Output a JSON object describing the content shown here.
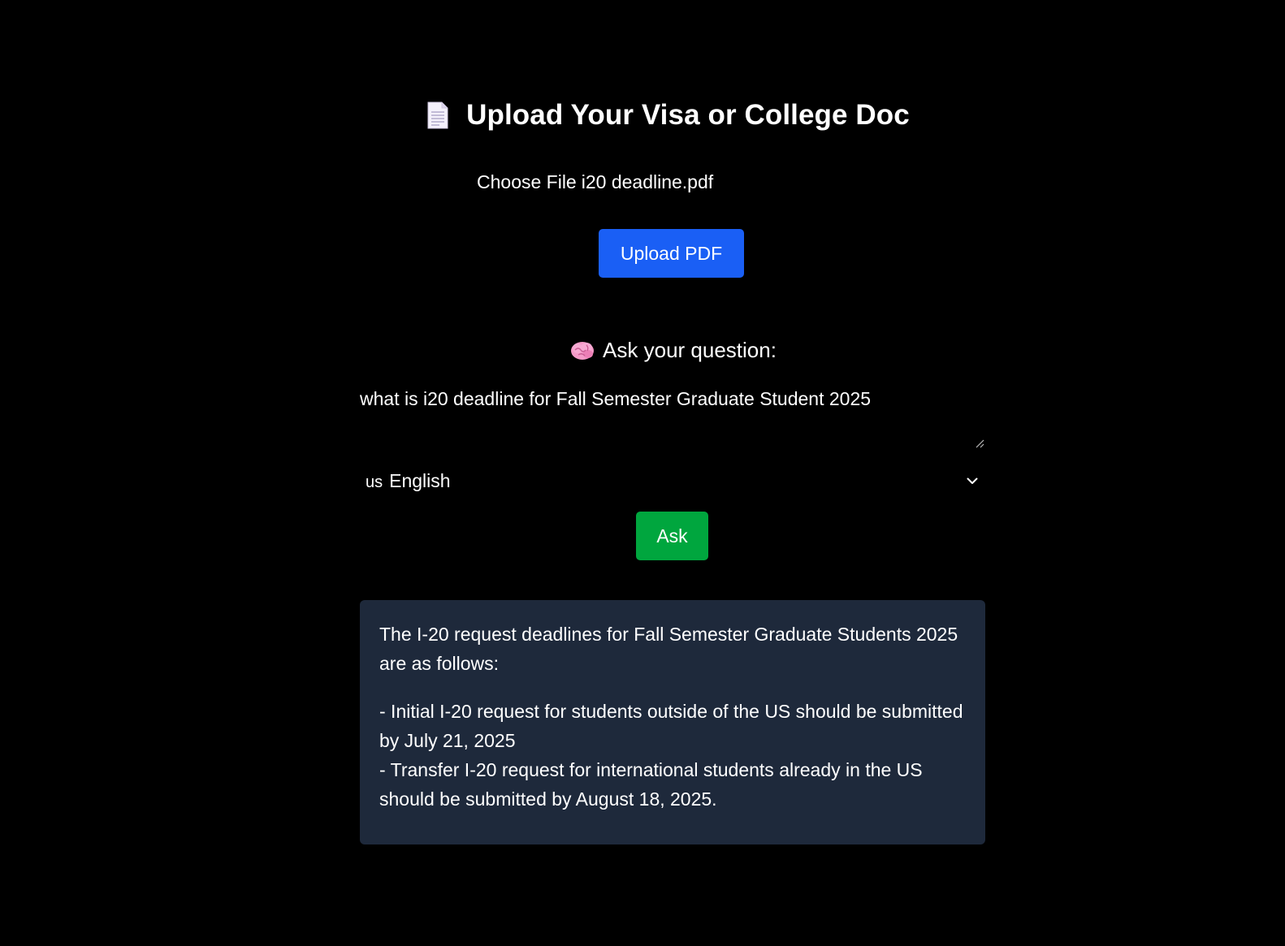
{
  "header": {
    "title": "Upload Your Visa or College Doc"
  },
  "upload": {
    "choose_label": "Choose File",
    "file_name": "i20 deadline.pdf",
    "button_label": "Upload PDF"
  },
  "question": {
    "label": "Ask your question:",
    "value": "what is i20 deadline for Fall Semester Graduate Student 2025"
  },
  "language": {
    "flag": "us",
    "selected": "English"
  },
  "ask": {
    "button_label": "Ask"
  },
  "answer": {
    "intro": "The I-20 request deadlines for Fall Semester Graduate Students 2025 are as follows:",
    "line1": "- Initial I-20 request for students outside of the US should be submitted by July 21, 2025",
    "line2": "- Transfer I-20 request for international students already in the US should be submitted by August 18, 2025."
  },
  "colors": {
    "background": "#000000",
    "upload_button": "#1a5ff5",
    "ask_button": "#00a63e",
    "answer_panel": "#1e293b",
    "text": "#ffffff"
  },
  "icons": {
    "title_icon": "document-icon",
    "label_icon": "brain-icon",
    "select_icon": "chevron-down-icon"
  }
}
